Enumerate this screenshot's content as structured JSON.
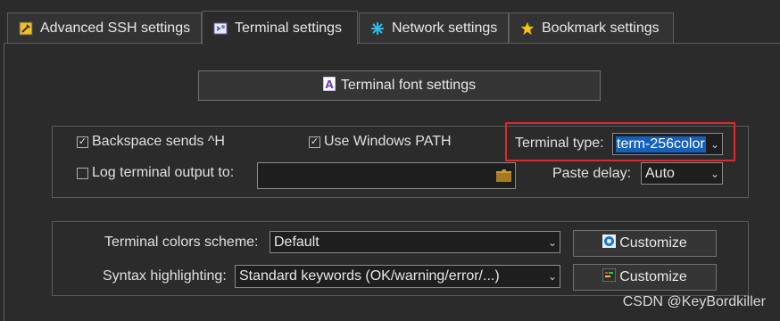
{
  "tabs": [
    {
      "label": "Advanced SSH settings",
      "icon": "wrench-icon",
      "active": false
    },
    {
      "label": "Terminal settings",
      "icon": "terminal-icon",
      "active": true
    },
    {
      "label": "Network settings",
      "icon": "network-icon",
      "active": false
    },
    {
      "label": "Bookmark settings",
      "icon": "star-icon",
      "active": false
    }
  ],
  "font_button": {
    "label": "Terminal font settings",
    "icon": "font-icon"
  },
  "options": {
    "backspace": {
      "label": "Backspace sends ^H",
      "checked": true
    },
    "windows_path": {
      "label": "Use Windows PATH",
      "checked": true
    },
    "log_output": {
      "label": "Log terminal output to:",
      "checked": false,
      "value": ""
    },
    "terminal_type": {
      "label": "Terminal type:",
      "value": "term-256color"
    },
    "paste_delay": {
      "label": "Paste delay:",
      "value": "Auto"
    }
  },
  "colors": {
    "scheme_label": "Terminal colors scheme:",
    "scheme_value": "Default",
    "syntax_label": "Syntax highlighting:",
    "syntax_value": "Standard keywords (OK/warning/error/...)",
    "customize_label_1": "Customize",
    "customize_label_2": "Customize"
  },
  "watermark": "CSDN @KeyBordkiller",
  "accent": {
    "highlight": "#1560bd",
    "callout": "#e0282b"
  }
}
